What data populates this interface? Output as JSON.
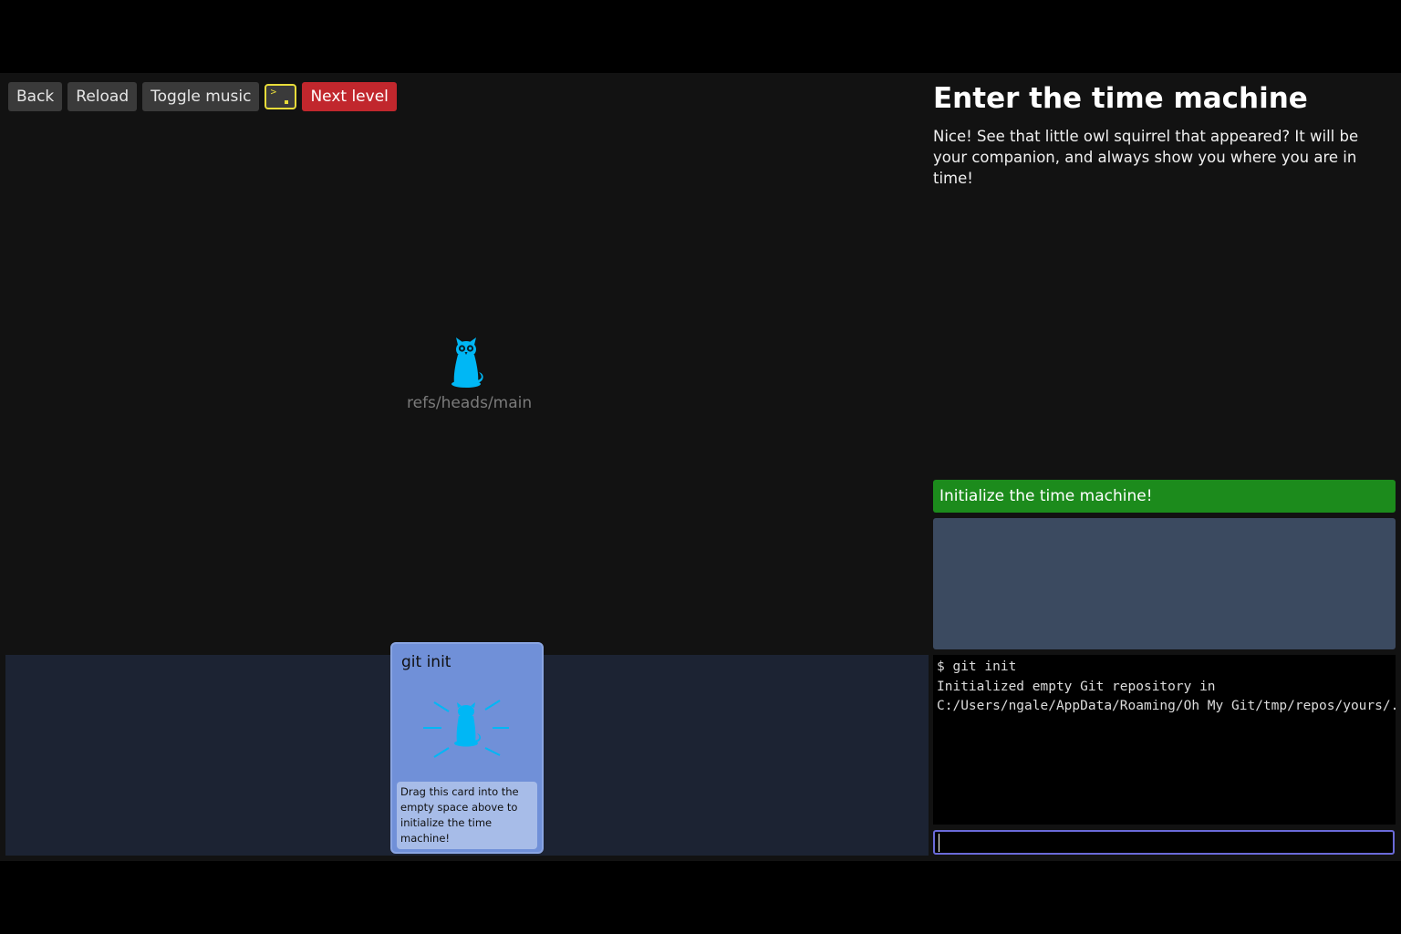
{
  "toolbar": {
    "back_label": "Back",
    "reload_label": "Reload",
    "music_label": "Toggle music",
    "terminal_glyph": ">",
    "next_label": "Next level"
  },
  "graph": {
    "head_ref": "refs/heads/main",
    "head_icon": "owl-squirrel-icon"
  },
  "card": {
    "title": "git init",
    "icon": "owl-squirrel-burst-icon",
    "description": "Drag this card into the empty space above to initialize the time machine!"
  },
  "level": {
    "title": "Enter the time machine",
    "description": "Nice! See that little owl squirrel that appeared? It will be your companion, and always show you where you are in time!"
  },
  "goal": {
    "text": "Initialize the time machine!"
  },
  "terminal": {
    "output": "$ git init\nInitialized empty Git repository in\nC:/Users/ngale/AppData/Roaming/Oh My Git/tmp/repos/yours/.git/",
    "input_value": ""
  },
  "colors": {
    "accent_goal": "#1c8b1c",
    "accent_next": "#c1272d",
    "owl": "#00b7f5",
    "card": "#7090d8",
    "terminal_border": "#e7dc3a"
  }
}
